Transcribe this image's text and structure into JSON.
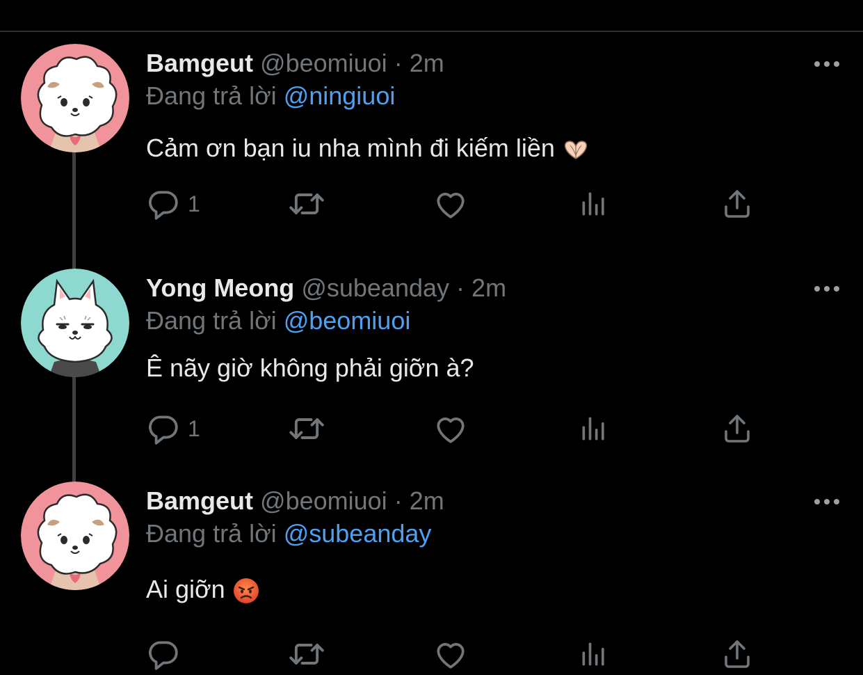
{
  "tweets": [
    {
      "name": "Bamgeut",
      "handle": "@beomiuoi",
      "separator": "·",
      "time": "2m",
      "reply_prefix": "Đang trả lời",
      "reply_to": "@ningiuoi",
      "text": "Cảm ơn bạn iu nha mình đi kiếm liền",
      "emoji": "heart-hands-emoji",
      "reply_count": "1",
      "avatar": {
        "icon": "white-puppy-avatar",
        "bg": "#f0939a"
      }
    },
    {
      "name": "Yong Meong",
      "handle": "@subeanday",
      "separator": "·",
      "time": "2m",
      "reply_prefix": "Đang trả lời",
      "reply_to": "@beomiuoi",
      "text": "Ê nãy giờ không phải giỡn à?",
      "emoji": "",
      "reply_count": "1",
      "avatar": {
        "icon": "white-cat-avatar",
        "bg": "#8ed9cf"
      }
    },
    {
      "name": "Bamgeut",
      "handle": "@beomiuoi",
      "separator": "·",
      "time": "2m",
      "reply_prefix": "Đang trả lời",
      "reply_to": "@subeanday",
      "text": "Ai giỡn",
      "emoji": "angry-face-emoji",
      "reply_count": "",
      "avatar": {
        "icon": "white-puppy-avatar",
        "bg": "#f0939a"
      }
    }
  ],
  "colors": {
    "background": "#000000",
    "text": "#e7e9ea",
    "secondary": "#71767b",
    "mention": "#4ea1f0",
    "thread_line": "#3d4144"
  }
}
